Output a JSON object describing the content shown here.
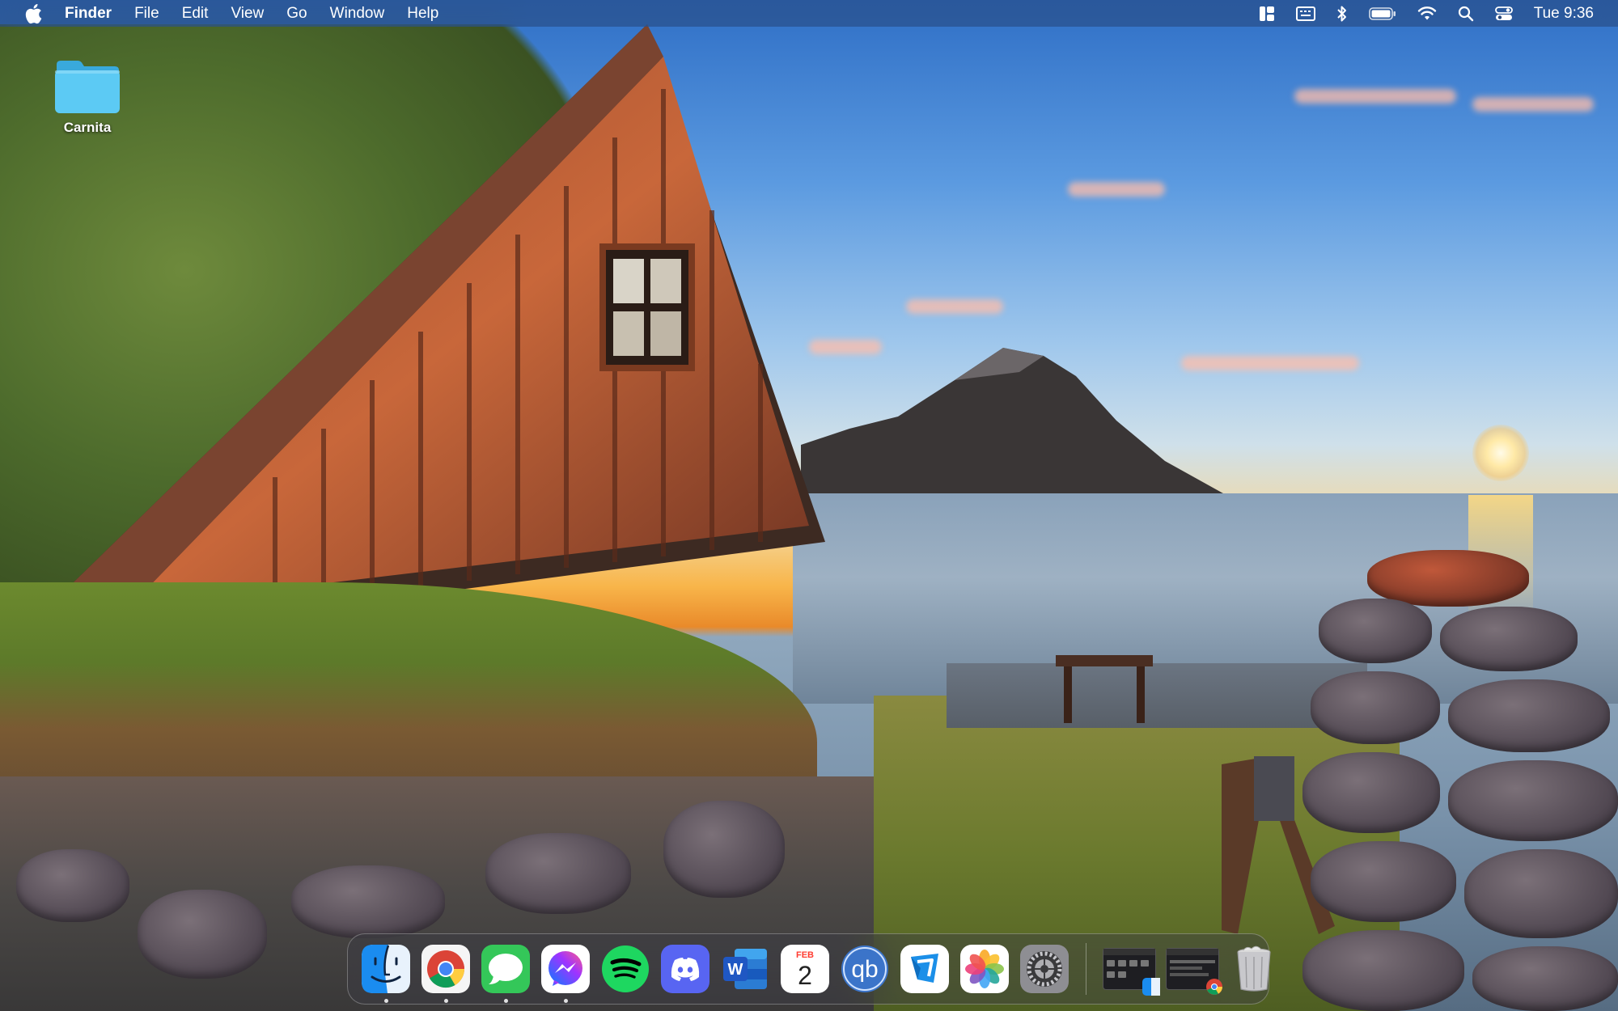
{
  "menubar": {
    "app_name": "Finder",
    "menus": [
      "File",
      "Edit",
      "View",
      "Go",
      "Window",
      "Help"
    ],
    "status_icons": [
      "stage-manager-icon",
      "keyboard-viewer-icon",
      "bluetooth-icon",
      "battery-icon",
      "wifi-icon",
      "spotlight-search-icon",
      "control-center-icon"
    ],
    "clock": "Tue 9:36"
  },
  "desktop": {
    "items": [
      {
        "label": "Carnita",
        "icon": "folder-icon",
        "color": "#4fc3f0"
      }
    ]
  },
  "dock": {
    "apps": [
      {
        "name": "Finder",
        "icon": "finder-icon",
        "running": true
      },
      {
        "name": "Google Chrome",
        "icon": "chrome-icon",
        "running": true
      },
      {
        "name": "Messages",
        "icon": "messages-icon",
        "running": true
      },
      {
        "name": "Messenger",
        "icon": "messenger-icon",
        "running": true
      },
      {
        "name": "Spotify",
        "icon": "spotify-icon",
        "running": false
      },
      {
        "name": "Discord",
        "icon": "discord-icon",
        "running": false
      },
      {
        "name": "Microsoft Word",
        "icon": "word-icon",
        "running": false
      },
      {
        "name": "Calendar",
        "icon": "calendar-icon",
        "running": false,
        "month": "FEB",
        "day": "2"
      },
      {
        "name": "qBittorrent",
        "icon": "qbittorrent-icon",
        "running": false,
        "text": "qb"
      },
      {
        "name": "Email Client",
        "icon": "mail-icon",
        "running": false
      },
      {
        "name": "Photos",
        "icon": "photos-icon",
        "running": false
      },
      {
        "name": "System Settings",
        "icon": "system-settings-icon",
        "running": false
      }
    ],
    "minimized": [
      {
        "name": "Minimized Finder window",
        "badge": "finder-badge-icon"
      },
      {
        "name": "Minimized Chrome window",
        "badge": "chrome-badge-icon"
      }
    ],
    "trash": {
      "name": "Trash",
      "icon": "trash-icon"
    }
  },
  "colors": {
    "menubar": "#26467a",
    "folder": "#4fc3f0",
    "spotify": "#1ed760",
    "discord": "#5865f2",
    "word": "#1f57c3",
    "messages": "#34c759"
  }
}
